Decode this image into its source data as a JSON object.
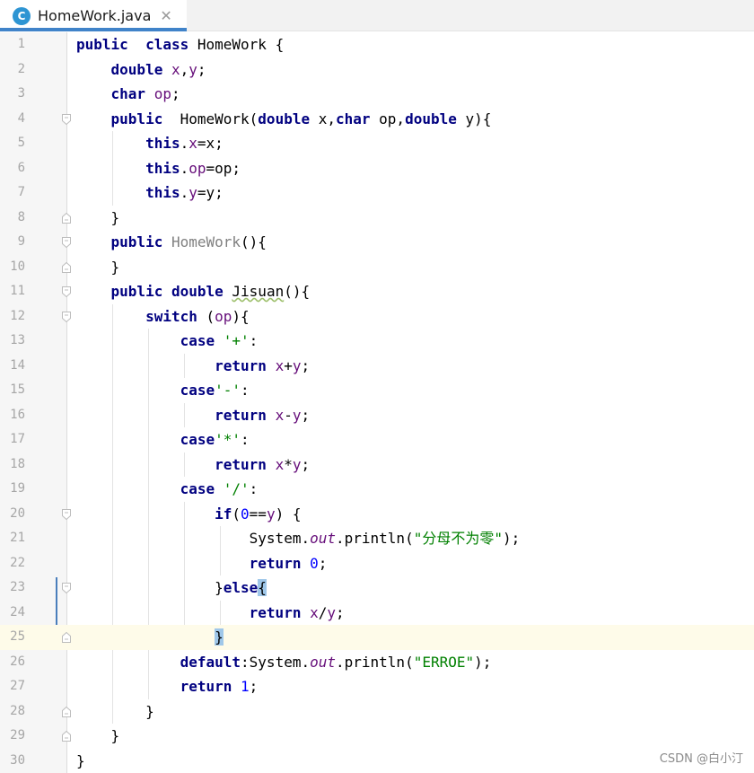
{
  "tab": {
    "filename": "HomeWork.java",
    "file_icon_letter": "C",
    "close_glyph": "✕"
  },
  "watermark": "CSDN @白小汀",
  "lines": [
    {
      "n": "1",
      "fold": "none",
      "hl": false,
      "tokens": [
        [
          "kw",
          "public"
        ],
        [
          "",
          "  "
        ],
        [
          "kw",
          "class"
        ],
        [
          "",
          " HomeWork {"
        ]
      ]
    },
    {
      "n": "2",
      "fold": "none",
      "hl": false,
      "tokens": [
        [
          "",
          "    "
        ],
        [
          "kw",
          "double"
        ],
        [
          "",
          " "
        ],
        [
          "fld",
          "x"
        ],
        [
          "",
          ","
        ],
        [
          "fld",
          "y"
        ],
        [
          "",
          ";"
        ]
      ]
    },
    {
      "n": "3",
      "fold": "none",
      "hl": false,
      "tokens": [
        [
          "",
          "    "
        ],
        [
          "kw",
          "char"
        ],
        [
          "",
          " "
        ],
        [
          "fld",
          "op"
        ],
        [
          "",
          ";"
        ]
      ]
    },
    {
      "n": "4",
      "fold": "open",
      "hl": false,
      "tokens": [
        [
          "",
          "    "
        ],
        [
          "kw",
          "public"
        ],
        [
          "",
          "  HomeWork("
        ],
        [
          "kw",
          "double"
        ],
        [
          "",
          " x,"
        ],
        [
          "kw",
          "char"
        ],
        [
          "",
          " op,"
        ],
        [
          "kw",
          "double"
        ],
        [
          "",
          " y){"
        ]
      ]
    },
    {
      "n": "5",
      "fold": "none",
      "hl": false,
      "tokens": [
        [
          "",
          "        "
        ],
        [
          "kw",
          "this"
        ],
        [
          "",
          "."
        ],
        [
          "fld",
          "x"
        ],
        [
          "",
          "=x;"
        ]
      ]
    },
    {
      "n": "6",
      "fold": "none",
      "hl": false,
      "tokens": [
        [
          "",
          "        "
        ],
        [
          "kw",
          "this"
        ],
        [
          "",
          "."
        ],
        [
          "fld",
          "op"
        ],
        [
          "",
          "=op;"
        ]
      ]
    },
    {
      "n": "7",
      "fold": "none",
      "hl": false,
      "tokens": [
        [
          "",
          "        "
        ],
        [
          "kw",
          "this"
        ],
        [
          "",
          "."
        ],
        [
          "fld",
          "y"
        ],
        [
          "",
          "=y;"
        ]
      ]
    },
    {
      "n": "8",
      "fold": "close",
      "hl": false,
      "tokens": [
        [
          "",
          "    }"
        ]
      ]
    },
    {
      "n": "9",
      "fold": "open",
      "hl": false,
      "tokens": [
        [
          "",
          "    "
        ],
        [
          "kw",
          "public"
        ],
        [
          "",
          " "
        ],
        [
          "gray",
          "HomeWork"
        ],
        [
          "",
          "(){"
        ]
      ]
    },
    {
      "n": "10",
      "fold": "close",
      "hl": false,
      "tokens": [
        [
          "",
          "    }"
        ]
      ]
    },
    {
      "n": "11",
      "fold": "open",
      "hl": false,
      "tokens": [
        [
          "",
          "    "
        ],
        [
          "kw",
          "public"
        ],
        [
          "",
          " "
        ],
        [
          "kw",
          "double"
        ],
        [
          "",
          " "
        ],
        [
          "wave",
          "Jisuan"
        ],
        [
          "",
          "(){"
        ]
      ]
    },
    {
      "n": "12",
      "fold": "open",
      "hl": false,
      "tokens": [
        [
          "",
          "        "
        ],
        [
          "kw",
          "switch"
        ],
        [
          "",
          " ("
        ],
        [
          "fld",
          "op"
        ],
        [
          "",
          "){"
        ]
      ]
    },
    {
      "n": "13",
      "fold": "none",
      "hl": false,
      "tokens": [
        [
          "",
          "            "
        ],
        [
          "kw",
          "case"
        ],
        [
          "",
          " "
        ],
        [
          "str",
          "'+'"
        ],
        [
          "",
          ":"
        ]
      ]
    },
    {
      "n": "14",
      "fold": "none",
      "hl": false,
      "tokens": [
        [
          "",
          "                "
        ],
        [
          "kw",
          "return"
        ],
        [
          "",
          " "
        ],
        [
          "fld",
          "x"
        ],
        [
          "",
          "+"
        ],
        [
          "fld",
          "y"
        ],
        [
          "",
          ";"
        ]
      ]
    },
    {
      "n": "15",
      "fold": "none",
      "hl": false,
      "tokens": [
        [
          "",
          "            "
        ],
        [
          "kw",
          "case"
        ],
        [
          "str",
          "'-'"
        ],
        [
          "",
          ":"
        ]
      ]
    },
    {
      "n": "16",
      "fold": "none",
      "hl": false,
      "tokens": [
        [
          "",
          "                "
        ],
        [
          "kw",
          "return"
        ],
        [
          "",
          " "
        ],
        [
          "fld",
          "x"
        ],
        [
          "",
          "-"
        ],
        [
          "fld",
          "y"
        ],
        [
          "",
          ";"
        ]
      ]
    },
    {
      "n": "17",
      "fold": "none",
      "hl": false,
      "tokens": [
        [
          "",
          "            "
        ],
        [
          "kw",
          "case"
        ],
        [
          "str",
          "'*'"
        ],
        [
          "",
          ":"
        ]
      ]
    },
    {
      "n": "18",
      "fold": "none",
      "hl": false,
      "tokens": [
        [
          "",
          "                "
        ],
        [
          "kw",
          "return"
        ],
        [
          "",
          " "
        ],
        [
          "fld",
          "x"
        ],
        [
          "",
          "*"
        ],
        [
          "fld",
          "y"
        ],
        [
          "",
          ";"
        ]
      ]
    },
    {
      "n": "19",
      "fold": "none",
      "hl": false,
      "tokens": [
        [
          "",
          "            "
        ],
        [
          "kw",
          "case"
        ],
        [
          "",
          " "
        ],
        [
          "str",
          "'/'"
        ],
        [
          "",
          ":"
        ]
      ]
    },
    {
      "n": "20",
      "fold": "open",
      "hl": false,
      "tokens": [
        [
          "",
          "                "
        ],
        [
          "kw",
          "if"
        ],
        [
          "",
          "("
        ],
        [
          "num",
          "0"
        ],
        [
          "",
          "=="
        ],
        [
          "fld",
          "y"
        ],
        [
          "",
          ") {"
        ]
      ]
    },
    {
      "n": "21",
      "fold": "none",
      "hl": false,
      "tokens": [
        [
          "",
          "                    System."
        ],
        [
          "fld it",
          "out"
        ],
        [
          "",
          ".println("
        ],
        [
          "str",
          "\"分母不为零\""
        ],
        [
          "",
          ");"
        ]
      ]
    },
    {
      "n": "22",
      "fold": "none",
      "hl": false,
      "tokens": [
        [
          "",
          "                    "
        ],
        [
          "kw",
          "return"
        ],
        [
          "",
          " "
        ],
        [
          "num",
          "0"
        ],
        [
          "",
          ";"
        ]
      ]
    },
    {
      "n": "23",
      "fold": "open",
      "hl": false,
      "tokens": [
        [
          "",
          "                }"
        ],
        [
          "kw",
          "else"
        ],
        [
          "match",
          "{"
        ]
      ]
    },
    {
      "n": "24",
      "fold": "none",
      "hl": false,
      "tokens": [
        [
          "",
          "                    "
        ],
        [
          "kw",
          "return"
        ],
        [
          "",
          " "
        ],
        [
          "fld",
          "x"
        ],
        [
          "",
          "/"
        ],
        [
          "fld",
          "y"
        ],
        [
          "",
          ";"
        ]
      ]
    },
    {
      "n": "25",
      "fold": "close",
      "hl": true,
      "tokens": [
        [
          "",
          "                "
        ],
        [
          "match",
          "}"
        ]
      ]
    },
    {
      "n": "26",
      "fold": "none",
      "hl": false,
      "tokens": [
        [
          "",
          "            "
        ],
        [
          "kw",
          "default"
        ],
        [
          "",
          ":System."
        ],
        [
          "fld it",
          "out"
        ],
        [
          "",
          ".println("
        ],
        [
          "str",
          "\"ERROE\""
        ],
        [
          "",
          ");"
        ]
      ]
    },
    {
      "n": "27",
      "fold": "none",
      "hl": false,
      "tokens": [
        [
          "",
          "            "
        ],
        [
          "kw",
          "return"
        ],
        [
          "",
          " "
        ],
        [
          "num",
          "1"
        ],
        [
          "",
          ";"
        ]
      ]
    },
    {
      "n": "28",
      "fold": "close",
      "hl": false,
      "tokens": [
        [
          "",
          "        }"
        ]
      ]
    },
    {
      "n": "29",
      "fold": "close",
      "hl": false,
      "tokens": [
        [
          "",
          "    }"
        ]
      ]
    },
    {
      "n": "30",
      "fold": "none",
      "hl": false,
      "tokens": [
        [
          "",
          "}"
        ]
      ]
    }
  ]
}
